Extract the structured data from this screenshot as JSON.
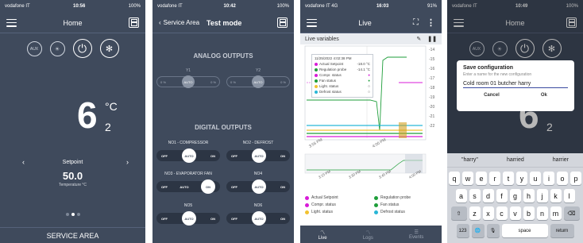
{
  "panel1": {
    "status_carrier": "vodafone IT",
    "status_time": "10:56",
    "status_battery": "100%",
    "title": "Home",
    "mode_icons": [
      "aux-icon",
      "light-icon",
      "power-icon",
      "defrost-icon"
    ],
    "aux_label": "AUX",
    "big_value": "6",
    "unit": "°C",
    "probe_number": "2",
    "setpoint_label": "Setpoint",
    "setpoint_value": "50.0",
    "setpoint_unit": "Temperature °C",
    "footer": "SERVICE AREA"
  },
  "panel2": {
    "status_carrier": "vodafone IT",
    "status_time": "10:42",
    "status_battery": "100%",
    "back_label": "Service Area",
    "title": "Test mode",
    "analog_title": "ANALOG OUTPUTS",
    "analog": [
      {
        "label": "Y1",
        "left": "0 %",
        "knob": "AUTO",
        "right": "0 %"
      },
      {
        "label": "Y2",
        "left": "0 %",
        "knob": "AUTO",
        "right": "0 %"
      }
    ],
    "digital_title": "DIGITAL OUTPUTS",
    "digital": [
      {
        "label": "NO1 - COMPRESSOR",
        "off": "OFF",
        "auto": "AUTO",
        "on": "ON",
        "selected": "auto"
      },
      {
        "label": "NO2 - DEFROST",
        "off": "OFF",
        "auto": "AUTO",
        "on": "ON",
        "selected": "auto"
      },
      {
        "label": "NO3 - EVAPORATOR FAN",
        "off": "OFF",
        "auto": "AUTO",
        "on": "ON",
        "selected": "on"
      },
      {
        "label": "NO4",
        "off": "OFF",
        "auto": "AUTO",
        "on": "ON",
        "selected": "auto"
      },
      {
        "label": "NO5",
        "off": "OFF",
        "auto": "AUTO",
        "on": "ON",
        "selected": "auto"
      },
      {
        "label": "NO6",
        "off": "OFF",
        "auto": "AUTO",
        "on": "ON",
        "selected": "auto"
      }
    ]
  },
  "panel3": {
    "status_carrier": "vodafone IT  4G",
    "status_time": "16:03",
    "status_battery": "91%",
    "title": "Live",
    "subtitle": "Live variables",
    "tooltip": {
      "datetime": "11/25/2022 4:02:38 PM",
      "rows": [
        {
          "name": "Actual Setpoint",
          "value": "-18.0 °C",
          "color": "#d81bd8"
        },
        {
          "name": "Regulation probe",
          "value": "-14.1 °C",
          "color": "#1e9e3a"
        },
        {
          "name": "Compr. status",
          "value": "●",
          "color": "#d81bd8"
        },
        {
          "name": "Fan status",
          "value": "●",
          "color": "#1e9e3a"
        },
        {
          "name": "Light. status",
          "value": "○",
          "color": "#f2c230"
        },
        {
          "name": "Defrost status",
          "value": "○",
          "color": "#29b6d6"
        }
      ]
    },
    "y_ticks": [
      "-14",
      "-15",
      "-16",
      "-17",
      "-18",
      "-19",
      "-20",
      "-21",
      "-22"
    ],
    "x_ticks_main": [
      "3:55 PM",
      "4:00 PM"
    ],
    "x_ticks_nav": [
      "3:15 PM",
      "3:30 PM",
      "3:45 PM",
      "4:00 PM"
    ],
    "legend": [
      {
        "name": "Actual Setpoint",
        "color": "#d81bd8"
      },
      {
        "name": "Regulation probe",
        "color": "#1e9e3a"
      },
      {
        "name": "Compr. status",
        "color": "#d81bd8"
      },
      {
        "name": "Fan status",
        "color": "#1e9e3a"
      },
      {
        "name": "Light. status",
        "color": "#f2c230"
      },
      {
        "name": "Defrost status",
        "color": "#29b6d6"
      }
    ],
    "tabs": [
      "Live",
      "Logs",
      "Events"
    ]
  },
  "panel4": {
    "status_carrier": "vodafone IT",
    "status_time": "10:49",
    "status_battery": "100%",
    "title": "Home",
    "big_value": "6",
    "probe_number": "2",
    "dialog_title": "Save configuration",
    "dialog_hint": "Enter a name for the new configuration",
    "dialog_value": "Cold room 01 butcher harry",
    "cancel": "Cancel",
    "ok": "Ok",
    "suggestions": [
      "\"harry\"",
      "harried",
      "harrier"
    ],
    "row1": [
      "q",
      "w",
      "e",
      "r",
      "t",
      "y",
      "u",
      "i",
      "o",
      "p"
    ],
    "row2": [
      "a",
      "s",
      "d",
      "f",
      "g",
      "h",
      "j",
      "k",
      "l"
    ],
    "row3": [
      "z",
      "x",
      "c",
      "v",
      "b",
      "n",
      "m"
    ],
    "num_key": "123",
    "space_key": "space",
    "return_key": "return"
  }
}
